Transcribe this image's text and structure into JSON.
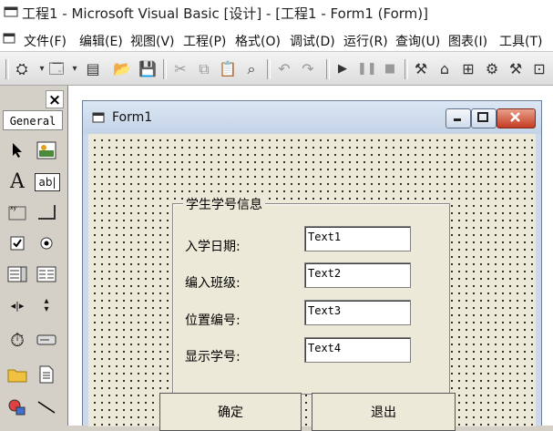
{
  "window": {
    "title": "工程1 - Microsoft Visual Basic [设计] - [工程1 - Form1 (Form)]"
  },
  "menu": {
    "items": [
      "文件(F)",
      "编辑(E)",
      "视图(V)",
      "工程(P)",
      "格式(O)",
      "调试(D)",
      "运行(R)",
      "查询(U)",
      "图表(I)",
      "工具(T)"
    ]
  },
  "toolbox": {
    "close_label": "×",
    "tab_label": "General",
    "tools": [
      "pointer-icon",
      "picturebox-icon",
      "label-icon",
      "textbox-icon",
      "frame-icon",
      "commandbutton-icon",
      "checkbox-icon",
      "optionbutton-icon",
      "combobox-icon",
      "listbox-icon",
      "hscrollbar-icon",
      "vscrollbar-icon",
      "timer-icon",
      "drivelistbox-icon",
      "dirlistbox-icon",
      "filelistbox-icon",
      "shape-icon",
      "line-icon"
    ],
    "label_glyph": "A",
    "textbox_glyph": "ab|"
  },
  "form": {
    "caption": "Form1",
    "frame_caption": "学生学号信息",
    "fields": [
      {
        "label": "入学日期:",
        "value": "Text1"
      },
      {
        "label": "编入班级:",
        "value": "Text2"
      },
      {
        "label": "位置编号:",
        "value": "Text3"
      },
      {
        "label": "显示学号:",
        "value": "Text4"
      }
    ],
    "buttons": {
      "ok": "确定",
      "exit": "退出"
    }
  },
  "colors": {
    "form_caption": "#c9d8eb",
    "close_button": "#c8452b",
    "client_bg": "#ece9d8"
  }
}
